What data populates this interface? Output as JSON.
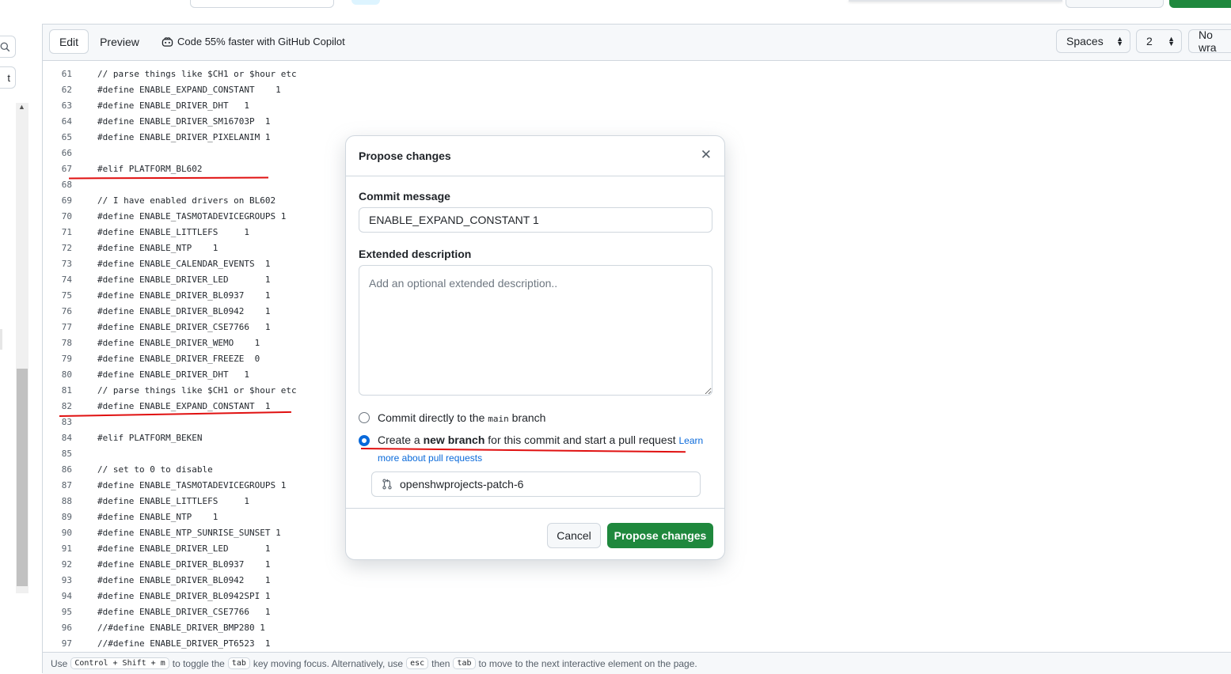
{
  "editor": {
    "tabs": {
      "edit": "Edit",
      "preview": "Preview"
    },
    "copilot_promo": "Code 55% faster with GitHub Copilot",
    "indent_mode": "Spaces",
    "indent_size": "2",
    "wrap_mode": "No wra",
    "sidebar_button": "t"
  },
  "code_lines": [
    {
      "n": "61",
      "t": "// parse things like $CH1 or $hour etc"
    },
    {
      "n": "62",
      "t": "#define ENABLE_EXPAND_CONSTANT    1"
    },
    {
      "n": "63",
      "t": "#define ENABLE_DRIVER_DHT   1"
    },
    {
      "n": "64",
      "t": "#define ENABLE_DRIVER_SM16703P  1"
    },
    {
      "n": "65",
      "t": "#define ENABLE_DRIVER_PIXELANIM 1"
    },
    {
      "n": "66",
      "t": ""
    },
    {
      "n": "67",
      "t": "#elif PLATFORM_BL602"
    },
    {
      "n": "68",
      "t": ""
    },
    {
      "n": "69",
      "t": "// I have enabled drivers on BL602"
    },
    {
      "n": "70",
      "t": "#define ENABLE_TASMOTADEVICEGROUPS 1"
    },
    {
      "n": "71",
      "t": "#define ENABLE_LITTLEFS     1"
    },
    {
      "n": "72",
      "t": "#define ENABLE_NTP    1"
    },
    {
      "n": "73",
      "t": "#define ENABLE_CALENDAR_EVENTS  1"
    },
    {
      "n": "74",
      "t": "#define ENABLE_DRIVER_LED       1"
    },
    {
      "n": "75",
      "t": "#define ENABLE_DRIVER_BL0937    1"
    },
    {
      "n": "76",
      "t": "#define ENABLE_DRIVER_BL0942    1"
    },
    {
      "n": "77",
      "t": "#define ENABLE_DRIVER_CSE7766   1"
    },
    {
      "n": "78",
      "t": "#define ENABLE_DRIVER_WEMO    1"
    },
    {
      "n": "79",
      "t": "#define ENABLE_DRIVER_FREEZE  0"
    },
    {
      "n": "80",
      "t": "#define ENABLE_DRIVER_DHT   1"
    },
    {
      "n": "81",
      "t": "// parse things like $CH1 or $hour etc"
    },
    {
      "n": "82",
      "t": "#define ENABLE_EXPAND_CONSTANT  1"
    },
    {
      "n": "83",
      "t": ""
    },
    {
      "n": "84",
      "t": "#elif PLATFORM_BEKEN"
    },
    {
      "n": "85",
      "t": ""
    },
    {
      "n": "86",
      "t": "// set to 0 to disable"
    },
    {
      "n": "87",
      "t": "#define ENABLE_TASMOTADEVICEGROUPS 1"
    },
    {
      "n": "88",
      "t": "#define ENABLE_LITTLEFS     1"
    },
    {
      "n": "89",
      "t": "#define ENABLE_NTP    1"
    },
    {
      "n": "90",
      "t": "#define ENABLE_NTP_SUNRISE_SUNSET 1"
    },
    {
      "n": "91",
      "t": "#define ENABLE_DRIVER_LED       1"
    },
    {
      "n": "92",
      "t": "#define ENABLE_DRIVER_BL0937    1"
    },
    {
      "n": "93",
      "t": "#define ENABLE_DRIVER_BL0942    1"
    },
    {
      "n": "94",
      "t": "#define ENABLE_DRIVER_BL0942SPI 1"
    },
    {
      "n": "95",
      "t": "#define ENABLE_DRIVER_CSE7766   1"
    },
    {
      "n": "96",
      "t": "//#define ENABLE_DRIVER_BMP280 1"
    },
    {
      "n": "97",
      "t": "//#define ENABLE_DRIVER_PT6523  1"
    }
  ],
  "statusbar": {
    "p1": "Use",
    "k1": "Control + Shift + m",
    "p2": "to toggle the",
    "k2": "tab",
    "p3": "key moving focus. Alternatively, use",
    "k3": "esc",
    "p4": "then",
    "k4": "tab",
    "p5": "to move to the next interactive element on the page."
  },
  "modal": {
    "title": "Propose changes",
    "commit_message_label": "Commit message",
    "commit_message_value": "ENABLE_EXPAND_CONSTANT 1",
    "extended_label": "Extended description",
    "extended_placeholder": "Add an optional extended description..",
    "option_direct": {
      "before": "Commit directly to the",
      "branch": "main",
      "after": "branch"
    },
    "option_new": {
      "before": "Create a",
      "strong": "new branch",
      "after": "for this commit and start a pull request",
      "link": "Learn more about pull requests"
    },
    "branch_name": "openshwprojects-patch-6",
    "cancel_label": "Cancel",
    "propose_label": "Propose changes"
  },
  "colors": {
    "primary": "#1f883d",
    "link": "#0969da",
    "annotation": "#e01010"
  }
}
